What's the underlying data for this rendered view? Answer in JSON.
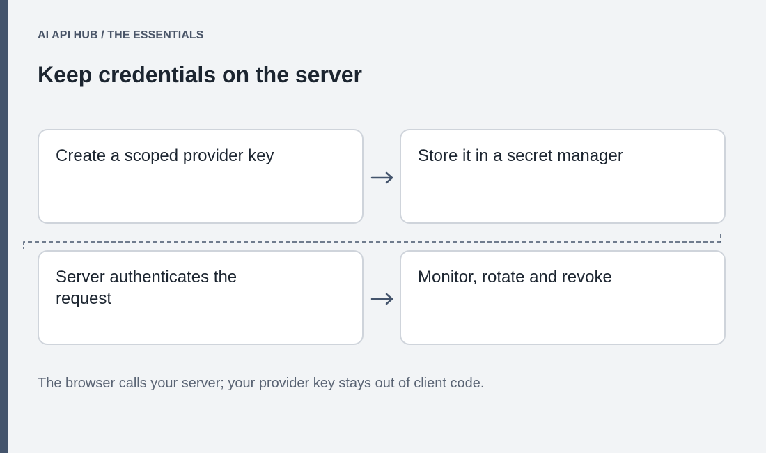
{
  "header": {
    "eyebrow": "AI API HUB / THE ESSENTIALS",
    "title": "Keep credentials on the server"
  },
  "steps": [
    {
      "label": "Create a scoped provider key"
    },
    {
      "label": "Store it in a secret manager"
    },
    {
      "label": "Server authenticates the request"
    },
    {
      "label": "Monitor, rotate and revoke"
    }
  ],
  "footer": {
    "note": "The browser calls your server; your provider key stays out of client code."
  },
  "colors": {
    "sidebar": "#44546c",
    "background": "#f2f4f6",
    "card_border": "#cfd4db",
    "arrow": "#44546c",
    "title_text": "#1c2530"
  },
  "icons": {
    "flow_arrow": "right-arrow-icon",
    "connector": "dashed-connector"
  }
}
